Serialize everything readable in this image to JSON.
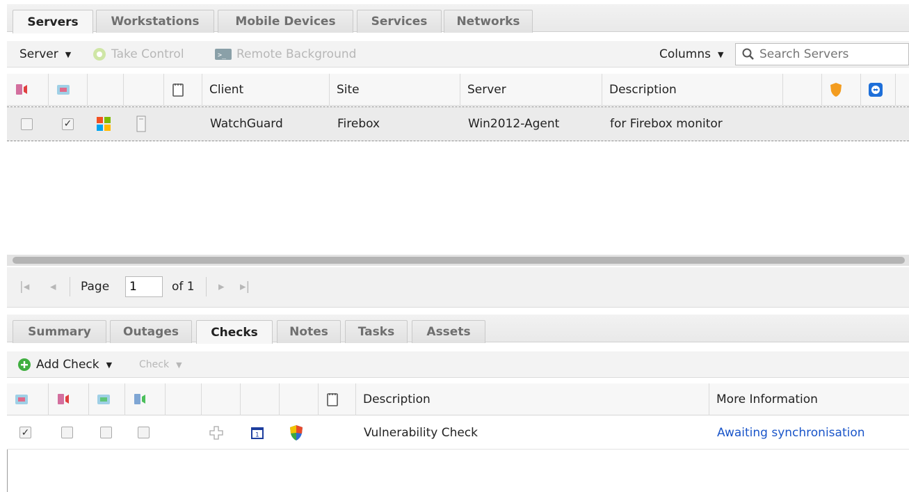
{
  "top_tabs": [
    {
      "label": "Servers",
      "active": true
    },
    {
      "label": "Workstations",
      "active": false
    },
    {
      "label": "Mobile Devices",
      "active": false
    },
    {
      "label": "Services",
      "active": false
    },
    {
      "label": "Networks",
      "active": false
    }
  ],
  "toolbar": {
    "server_menu": "Server",
    "take_control": "Take Control",
    "remote_background": "Remote Background",
    "columns": "Columns",
    "search_placeholder": "Search Servers"
  },
  "server_grid": {
    "columns": {
      "client": "Client",
      "site": "Site",
      "server": "Server",
      "description": "Description"
    },
    "rows": [
      {
        "checked_a": false,
        "checked_b": true,
        "client": "WatchGuard",
        "site": "Firebox",
        "server": "Win2012-Agent",
        "description": "for Firebox monitor"
      }
    ]
  },
  "pager": {
    "page_label": "Page",
    "page_value": "1",
    "of_label": "of 1"
  },
  "bottom_tabs": [
    {
      "label": "Summary",
      "active": false
    },
    {
      "label": "Outages",
      "active": false
    },
    {
      "label": "Checks",
      "active": true
    },
    {
      "label": "Notes",
      "active": false
    },
    {
      "label": "Tasks",
      "active": false
    },
    {
      "label": "Assets",
      "active": false
    }
  ],
  "checks_toolbar": {
    "add_check": "Add Check",
    "check_menu": "Check"
  },
  "checks_grid": {
    "columns": {
      "description": "Description",
      "more_info": "More Information"
    },
    "rows": [
      {
        "description": "Vulnerability Check",
        "more_info": "Awaiting synchronisation",
        "calendar_value": "1"
      }
    ]
  },
  "colors": {
    "link": "#1a55c9",
    "accent_green": "#3fae3f",
    "shield_orange": "#f39c1f",
    "teamviewer_blue": "#1e6fd9"
  }
}
